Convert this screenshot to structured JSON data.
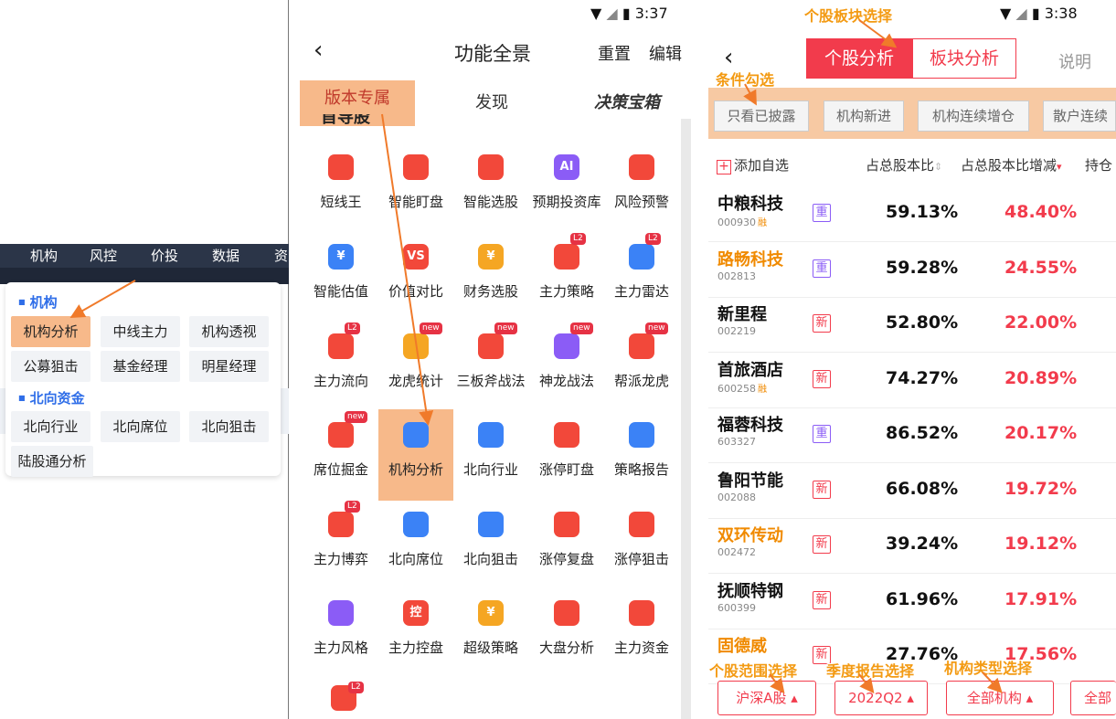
{
  "panel1": {
    "nav_tabs": [
      "机构",
      "风控",
      "价投",
      "数据",
      "资"
    ],
    "section1": "机构",
    "section1_items": [
      "机构分析",
      "中线主力",
      "机构透视",
      "公募狙击",
      "基金经理",
      "明星经理"
    ],
    "section2": "北向资金",
    "section2_items": [
      "北向行业",
      "北向席位",
      "北向狙击",
      "陆股通分析"
    ]
  },
  "panel2": {
    "time": "3:37",
    "title": "功能全景",
    "reset": "重置",
    "edit": "编辑",
    "tabs": [
      "版本专属",
      "发现",
      "决策宝箱"
    ],
    "section_title": "首导股",
    "items": [
      {
        "label": "短线王",
        "icon": "candle-icon",
        "color": "#f2483a"
      },
      {
        "label": "智能盯盘",
        "icon": "eye-icon",
        "color": "#f2483a"
      },
      {
        "label": "智能选股",
        "icon": "brain-icon",
        "color": "#f2483a"
      },
      {
        "label": "预期投资库",
        "icon": "ai-icon",
        "color": "#8b5cf6",
        "glyph": "AI"
      },
      {
        "label": "风险预警",
        "icon": "shield-icon",
        "color": "#f2483a"
      },
      {
        "label": "智能估值",
        "icon": "cloud-yuan-icon",
        "color": "#3b82f6",
        "glyph": "¥"
      },
      {
        "label": "价值对比",
        "icon": "vs-icon",
        "color": "#f2483a",
        "glyph": "VS"
      },
      {
        "label": "财务选股",
        "icon": "notebook-icon",
        "color": "#f5a623",
        "glyph": "¥"
      },
      {
        "label": "主力策略",
        "icon": "strategy-icon",
        "color": "#f2483a",
        "badge": "L2"
      },
      {
        "label": "主力雷达",
        "icon": "radar-icon",
        "color": "#3b82f6",
        "badge": "L2"
      },
      {
        "label": "主力流向",
        "icon": "flow-icon",
        "color": "#f2483a",
        "badge": "L2"
      },
      {
        "label": "龙虎统计",
        "icon": "calendar-icon",
        "color": "#f5a623",
        "badge": "new"
      },
      {
        "label": "三板斧战法",
        "icon": "rocket-icon",
        "color": "#f2483a",
        "badge": "new"
      },
      {
        "label": "神龙战法",
        "icon": "chart-icon",
        "color": "#8b5cf6",
        "badge": "new"
      },
      {
        "label": "帮派龙虎",
        "icon": "shield-list-icon",
        "color": "#f2483a",
        "badge": "new"
      },
      {
        "label": "席位掘金",
        "icon": "monitor-icon",
        "color": "#f2483a",
        "badge": "new"
      },
      {
        "label": "机构分析",
        "icon": "folder-search-icon",
        "color": "#3b82f6",
        "highlight": true
      },
      {
        "label": "北向行业",
        "icon": "bank-icon",
        "color": "#3b82f6"
      },
      {
        "label": "涨停盯盘",
        "icon": "limit-eye-icon",
        "color": "#f2483a"
      },
      {
        "label": "策略报告",
        "icon": "clipboard-icon",
        "color": "#3b82f6"
      },
      {
        "label": "主力博弈",
        "icon": "bag-icon",
        "color": "#f2483a",
        "badge": "L2"
      },
      {
        "label": "北向席位",
        "icon": "location-icon",
        "color": "#3b82f6"
      },
      {
        "label": "北向狙击",
        "icon": "target-icon",
        "color": "#3b82f6"
      },
      {
        "label": "涨停复盘",
        "icon": "replay-icon",
        "color": "#f2483a"
      },
      {
        "label": "涨停狙击",
        "icon": "crosshair-icon",
        "color": "#f2483a"
      },
      {
        "label": "主力风格",
        "icon": "clover-icon",
        "color": "#8b5cf6"
      },
      {
        "label": "主力控盘",
        "icon": "control-icon",
        "color": "#f2483a",
        "glyph": "控"
      },
      {
        "label": "超级策略",
        "icon": "bulb-icon",
        "color": "#f5a623",
        "glyph": "¥"
      },
      {
        "label": "大盘分析",
        "icon": "pulse-icon",
        "color": "#f2483a"
      },
      {
        "label": "主力资金",
        "icon": "flag-icon",
        "color": "#f2483a"
      }
    ],
    "last_badge": "L2"
  },
  "panel3": {
    "time": "3:38",
    "seg_left": "个股分析",
    "seg_right": "板块分析",
    "help": "说明",
    "filters": [
      "只看已披露",
      "机构新进",
      "机构连续增仓",
      "散户连续"
    ],
    "add_watch": "添加自选",
    "col1": "占总股本比",
    "col2": "占总股本比增减",
    "col3": "持仓",
    "rows": [
      {
        "name": "中粮科技",
        "code": "000930",
        "rz": "融",
        "tag": "重",
        "v1": "59.13%",
        "v2": "48.40%"
      },
      {
        "name": "路畅科技",
        "code": "002813",
        "rz": "",
        "tag": "重",
        "v1": "59.28%",
        "v2": "24.55%",
        "orange": true
      },
      {
        "name": "新里程",
        "code": "002219",
        "rz": "",
        "tag": "新",
        "v1": "52.80%",
        "v2": "22.00%"
      },
      {
        "name": "首旅酒店",
        "code": "600258",
        "rz": "融",
        "tag": "新",
        "v1": "74.27%",
        "v2": "20.89%"
      },
      {
        "name": "福蓉科技",
        "code": "603327",
        "rz": "",
        "tag": "重",
        "v1": "86.52%",
        "v2": "20.17%"
      },
      {
        "name": "鲁阳节能",
        "code": "002088",
        "rz": "",
        "tag": "新",
        "v1": "66.08%",
        "v2": "19.72%"
      },
      {
        "name": "双环传动",
        "code": "002472",
        "rz": "",
        "tag": "新",
        "v1": "39.24%",
        "v2": "19.12%",
        "orange": true
      },
      {
        "name": "抚顺特钢",
        "code": "600399",
        "rz": "",
        "tag": "新",
        "v1": "61.96%",
        "v2": "17.91%"
      },
      {
        "name": "固德威",
        "code": "",
        "rz": "",
        "tag": "新",
        "v1": "27.76%",
        "v2": "17.56%",
        "orange": true
      }
    ],
    "bottom": [
      "沪深A股 ▴",
      "2022Q2 ▴",
      "全部机构 ▴",
      "全部"
    ]
  },
  "annotations": {
    "stock_sector": "个股板块选择",
    "condition": "条件勾选",
    "scope": "个股范围选择",
    "quarter": "季度报告选择",
    "inst_type": "机构类型选择"
  }
}
